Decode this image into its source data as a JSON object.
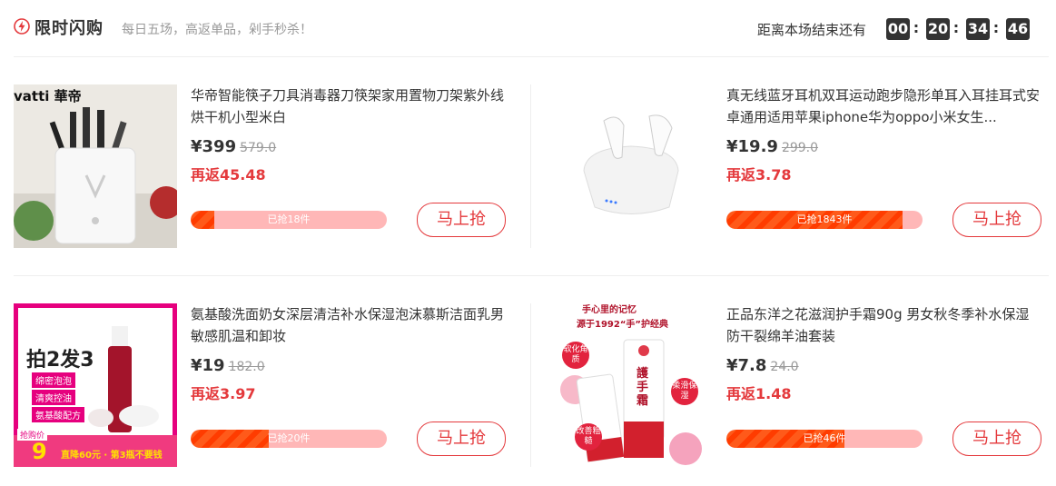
{
  "header": {
    "title": "限时闪购",
    "subtitle": "每日五场，高返单品，剁手秒杀！",
    "countdown_label": "距离本场结束还有",
    "countdown": {
      "hours": "00",
      "minutes": "20",
      "seconds": "34",
      "centis": "46"
    },
    "icon": "lightning-icon",
    "accent_color": "#e4393c"
  },
  "products": [
    {
      "name": "华帝智能筷子刀具消毒器刀筷架家用置物刀架紫外线烘干机小型米白",
      "price": "¥399",
      "original_price": "579.0",
      "rebate": "再返45.48",
      "sold_text": "已抢18件",
      "sold_progress": 0.12,
      "button": "马上抢",
      "brand_text": "vatti 華帝"
    },
    {
      "name": "真无线蓝牙耳机双耳运动跑步隐形单耳入耳挂耳式安卓通用适用苹果iphone华为oppo小米女生...",
      "price": "¥19.9",
      "original_price": "299.0",
      "rebate": "再返3.78",
      "sold_text": "已抢1843件",
      "sold_progress": 0.9,
      "button": "马上抢"
    },
    {
      "name": "氨基酸洗面奶女深层清洁补水保湿泡沫慕斯洁面乳男敏感肌温和卸妆",
      "price": "¥19",
      "original_price": "182.0",
      "rebate": "再返3.97",
      "sold_text": "已抢20件",
      "sold_progress": 0.4,
      "button": "马上抢",
      "promo": {
        "headline": "拍2发3",
        "tag1": "绵密泡泡",
        "tag2": "清爽控油",
        "tag3": "氨基酸配方",
        "price_label": "抢购价",
        "price": "9",
        "bottom": "直降60元 · 第3瓶不要钱"
      }
    },
    {
      "name": "正品东洋之花滋润护手霜90g 男女秋冬季补水保湿防干裂绵羊油套装",
      "price": "¥7.8",
      "original_price": "24.0",
      "rebate": "再返1.48",
      "sold_text": "已抢46件",
      "sold_progress": 0.6,
      "button": "马上抢",
      "promo": {
        "line1": "手心里的记忆",
        "line2": "源于1992“手”护经典",
        "badge1": "软化角质",
        "badge2": "柔滑保湿",
        "badge3": "改善粗糙",
        "tube": "護手霜"
      }
    }
  ]
}
